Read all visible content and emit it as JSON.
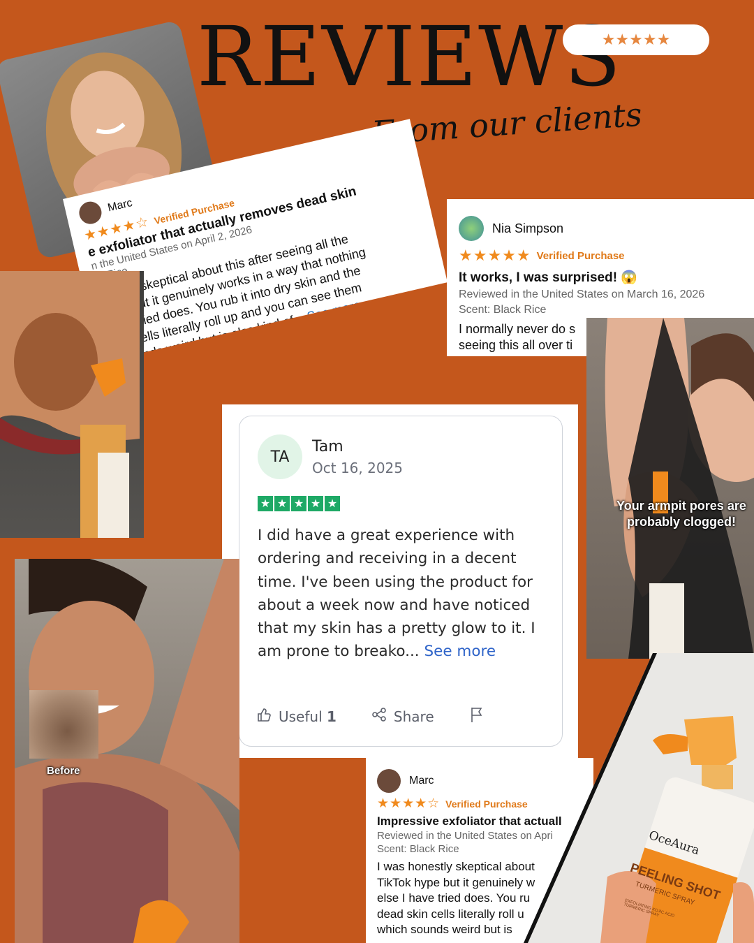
{
  "header": {
    "title": "REVIEWS",
    "subtitle": "From our clients",
    "stars": "★★★★★"
  },
  "review_marc_tilted": {
    "name": "Marc",
    "stars": "★★★★☆",
    "verified": "Verified Purchase",
    "title": "e exfoliator that actually removes dead skin",
    "meta": "n the United States on April 2, 2026",
    "scent": "ck Rice",
    "lines": [
      "onestly skeptical about this after seeing all the",
      "hype but it genuinely works in a way that nothing",
      "have tried does. You rub it into dry skin and the",
      "skin cells literally roll up and you can see them",
      "h sounds weird but is also kind of..."
    ],
    "see_more": "See more"
  },
  "review_nia": {
    "name": "Nia Simpson",
    "stars": "★★★★★",
    "verified": "Verified Purchase",
    "title": "It works, I was surprised! 😱",
    "meta": "Reviewed in the United States on March 16, 2026",
    "scent": "Scent: Black Rice",
    "line1": "I normally never do s",
    "line2": "seeing this all over ti"
  },
  "review_tam": {
    "initials": "TA",
    "name": "Tam",
    "date": "Oct 16, 2025",
    "text": "I did have a great experience with ordering and receiving in a decent time. I've been using the product for about a week now and have noticed that my skin has a pretty glow to it. I am prone to breako...",
    "see_more": "See more",
    "useful_label": "Useful",
    "useful_count": "1",
    "share_label": "Share"
  },
  "review_marc_bottom": {
    "name": "Marc",
    "stars": "★★★★☆",
    "verified": "Verified Purchase",
    "title": "Impressive exfoliator that actuall",
    "meta": "Reviewed in the United States on Apri",
    "scent": "Scent: Black Rice",
    "lines": [
      "I was honestly skeptical about",
      "TikTok hype but it genuinely w",
      "else I have tried does. You ru",
      "dead skin cells literally roll u",
      "which sounds weird but is"
    ]
  },
  "photos": {
    "armpit_caption": "Your armpit pores are probably clogged!",
    "before_label": "Before",
    "bottle_brand": "OceAura",
    "bottle_name": "PEELING SHOT",
    "bottle_sub": "TURMERIC SPRAY",
    "bottle_ingredients": "EXFOLIATING KOJIC ACID TURMERIC SPRAY"
  },
  "colors": {
    "background": "#c4571c",
    "star_orange": "#f08a1d",
    "trustpilot_green": "#1ea966",
    "link_blue": "#1e6dbb"
  }
}
